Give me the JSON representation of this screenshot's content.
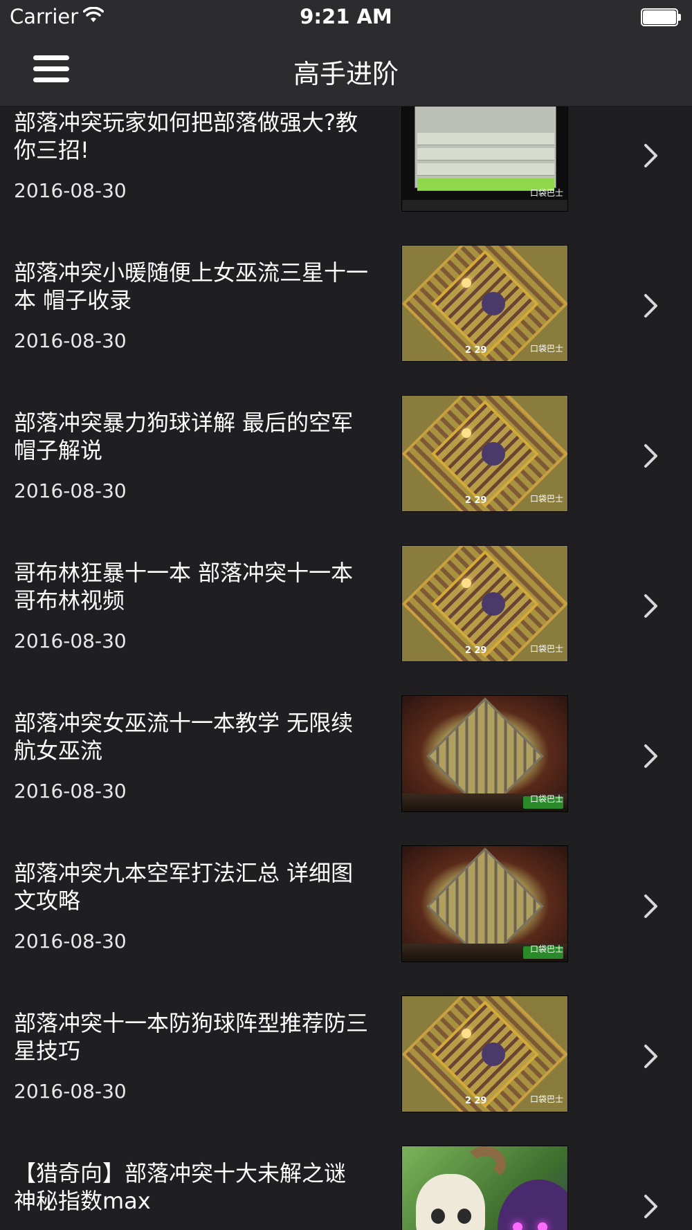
{
  "status": {
    "carrier": "Carrier",
    "time": "9:21 AM"
  },
  "nav": {
    "title": "高手进阶",
    "menu_icon": "hamburger-menu-icon"
  },
  "articles": [
    {
      "title": "部落冲突玩家如何把部落做强大?教你三招!",
      "date": "2016-08-30",
      "thumb": "screenshot",
      "logo": "口袋巴士"
    },
    {
      "title": "部落冲突小暖随便上女巫流三星十一本 帽子收录",
      "date": "2016-08-30",
      "thumb": "base",
      "logo": "口袋巴士",
      "score": "2 29"
    },
    {
      "title": "部落冲突暴力狗球详解 最后的空军帽子解说",
      "date": "2016-08-30",
      "thumb": "base",
      "logo": "口袋巴士",
      "score": "2 29"
    },
    {
      "title": "哥布林狂暴十一本 部落冲突十一本哥布林视频",
      "date": "2016-08-30",
      "thumb": "base",
      "logo": "口袋巴士",
      "score": "2 29"
    },
    {
      "title": "部落冲突女巫流十一本教学 无限续航女巫流",
      "date": "2016-08-30",
      "thumb": "lava",
      "logo": "口袋巴士"
    },
    {
      "title": "部落冲突九本空军打法汇总 详细图文攻略",
      "date": "2016-08-30",
      "thumb": "lava",
      "logo": "口袋巴士"
    },
    {
      "title": "部落冲突十一本防狗球阵型推荐防三星技巧",
      "date": "2016-08-30",
      "thumb": "base",
      "logo": "口袋巴士",
      "score": "2 29"
    },
    {
      "title": "【猎奇向】部落冲突十大未解之谜 神秘指数max",
      "date": "",
      "thumb": "art"
    }
  ],
  "colors": {
    "background": "#1f1f22",
    "bar": "#2c2c2e",
    "text": "#ffffff",
    "chevron": "#d8d8d8"
  }
}
